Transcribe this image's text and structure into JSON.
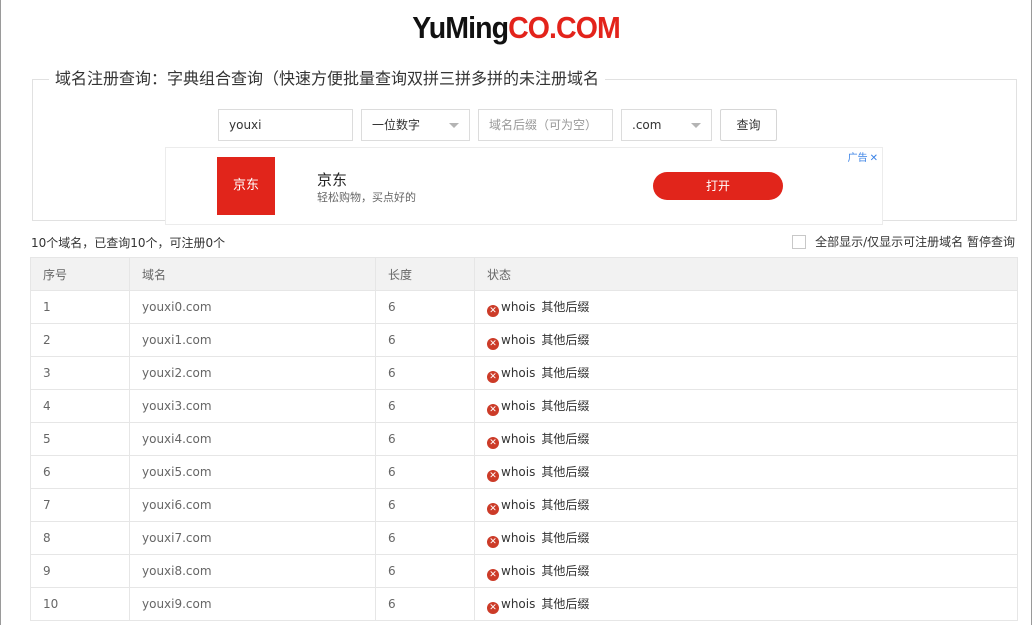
{
  "logo": {
    "part1": "YuMing",
    "part2": "CO.COM"
  },
  "panel": {
    "legend": "域名注册查询：字典组合查询（快速方便批量查询双拼三拼多拼的未注册域名",
    "form": {
      "keyword_value": "youxi",
      "pattern_select": "一位数字",
      "suffix_placeholder": "域名后缀（可为空）",
      "tld_select": ".com",
      "query_button": "查询"
    },
    "ad": {
      "logo_text": "京东",
      "title": "京东",
      "desc": "轻松购物，买点好的",
      "open_button": "打开",
      "badge": "广告"
    }
  },
  "summary": "10个域名，已查询10个，可注册0个",
  "toggle": {
    "label": "全部显示/仅显示可注册域名",
    "pause": "暂停查询"
  },
  "table": {
    "headers": [
      "序号",
      "域名",
      "长度",
      "状态"
    ],
    "rows": [
      {
        "no": "1",
        "domain": "youxi0.com",
        "length": "6",
        "whois": "whois",
        "other": "其他后缀"
      },
      {
        "no": "2",
        "domain": "youxi1.com",
        "length": "6",
        "whois": "whois",
        "other": "其他后缀"
      },
      {
        "no": "3",
        "domain": "youxi2.com",
        "length": "6",
        "whois": "whois",
        "other": "其他后缀"
      },
      {
        "no": "4",
        "domain": "youxi3.com",
        "length": "6",
        "whois": "whois",
        "other": "其他后缀"
      },
      {
        "no": "5",
        "domain": "youxi4.com",
        "length": "6",
        "whois": "whois",
        "other": "其他后缀"
      },
      {
        "no": "6",
        "domain": "youxi5.com",
        "length": "6",
        "whois": "whois",
        "other": "其他后缀"
      },
      {
        "no": "7",
        "domain": "youxi6.com",
        "length": "6",
        "whois": "whois",
        "other": "其他后缀"
      },
      {
        "no": "8",
        "domain": "youxi7.com",
        "length": "6",
        "whois": "whois",
        "other": "其他后缀"
      },
      {
        "no": "9",
        "domain": "youxi8.com",
        "length": "6",
        "whois": "whois",
        "other": "其他后缀"
      },
      {
        "no": "10",
        "domain": "youxi9.com",
        "length": "6",
        "whois": "whois",
        "other": "其他后缀"
      }
    ]
  },
  "colors": {
    "brand_red": "#e3231b",
    "ad_red": "#e1251b",
    "status_red": "#cc3b28"
  }
}
